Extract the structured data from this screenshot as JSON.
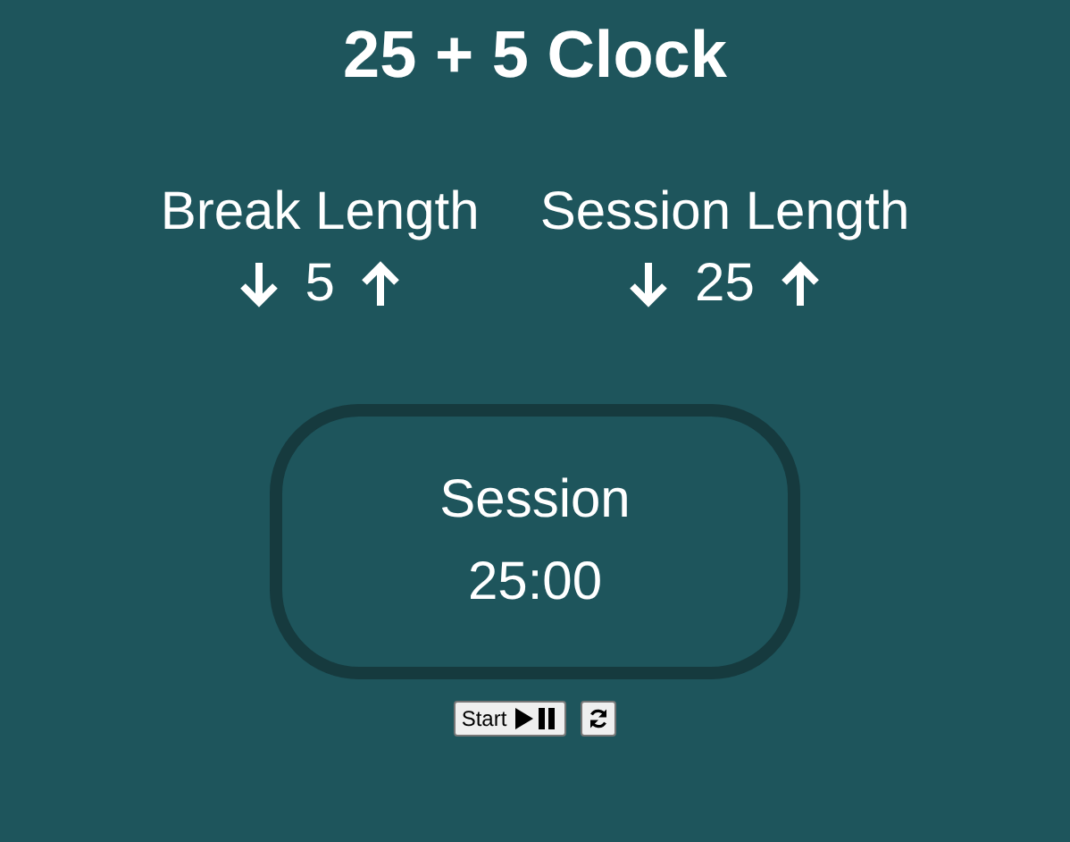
{
  "title": "25 + 5 Clock",
  "lengths": [
    {
      "label": "Break Length",
      "value": "5"
    },
    {
      "label": "Session Length",
      "value": "25"
    }
  ],
  "timer": {
    "label": "Session",
    "time": "25:00"
  },
  "controls": {
    "start_label": "Start"
  }
}
